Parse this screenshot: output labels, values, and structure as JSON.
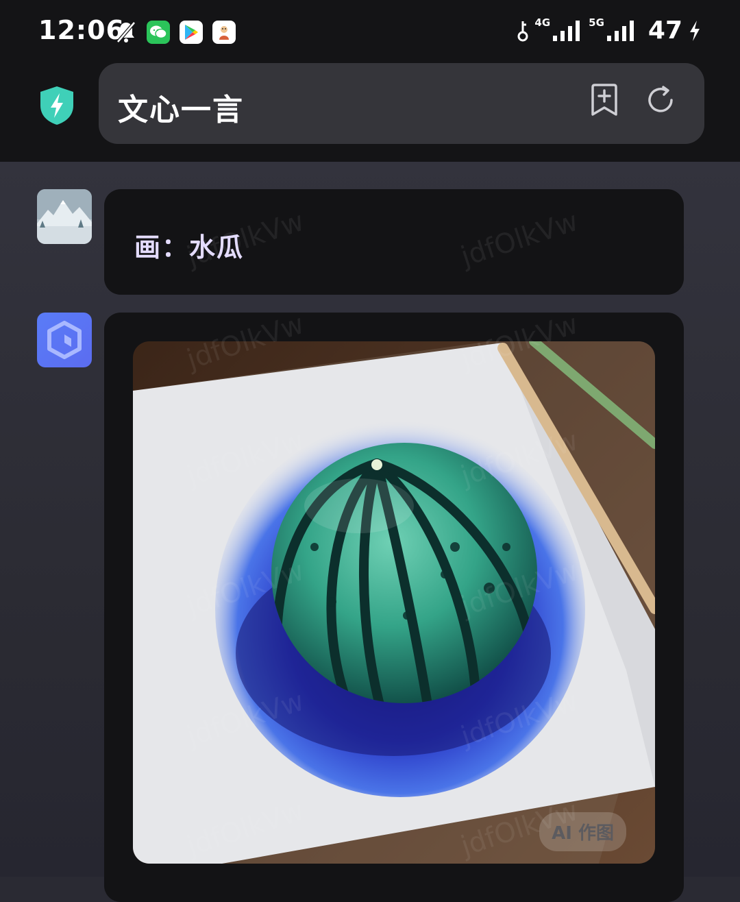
{
  "status_bar": {
    "time": "12:06",
    "signal_1": "4G",
    "signal_2": "5G",
    "battery": "47"
  },
  "header": {
    "title": "文心一言",
    "shield_icon": "shield-bolt-icon",
    "bookmark_icon": "add-bookmark-icon",
    "reload_icon": "reload-icon"
  },
  "conversation": {
    "user_prompt": "画：水瓜",
    "image_badge": "AI 作图",
    "watermark": "jdfOlkVw"
  },
  "colors": {
    "shield": "#3fd0b8",
    "bot_avatar": "#5a7cf7",
    "prompt_text": "#e4dcff"
  }
}
